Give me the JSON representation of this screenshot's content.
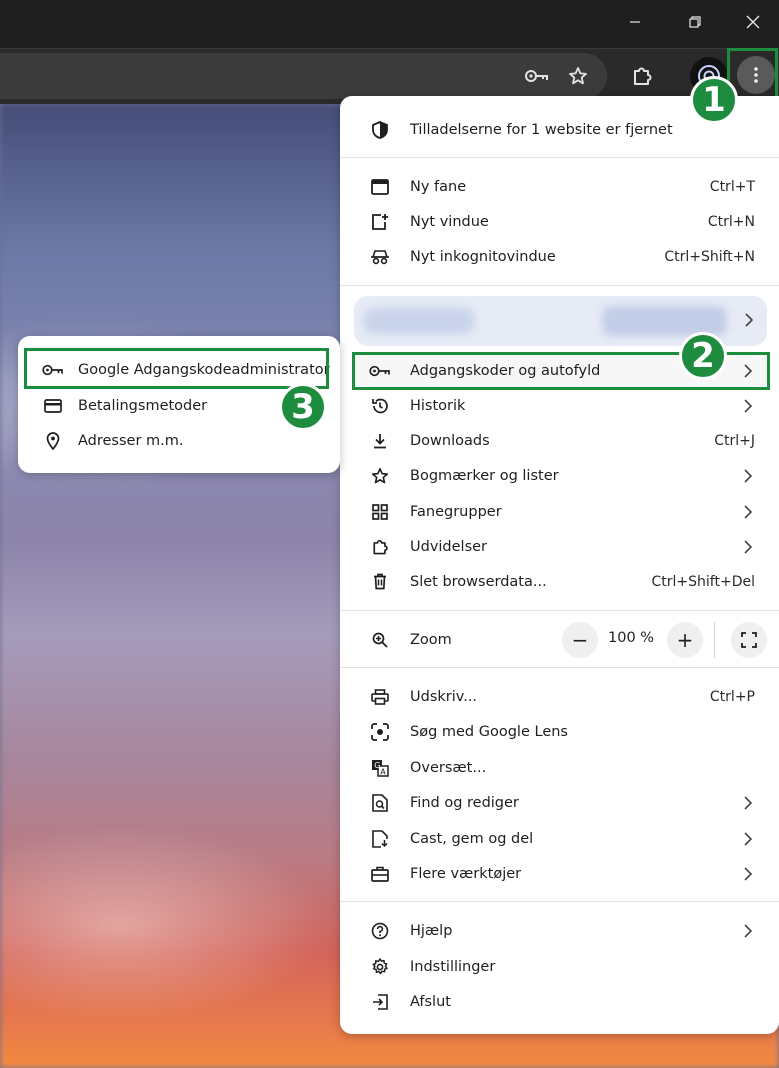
{
  "window": {
    "controls": {
      "minimize_icon": "minimize-icon",
      "restore_icon": "restore-icon",
      "close_icon": "close-icon"
    }
  },
  "toolbar": {
    "icons": [
      "key-icon",
      "star-icon",
      "extensions-icon",
      "profile-icon",
      "more-vert-icon"
    ]
  },
  "badges": {
    "one": "1",
    "two": "2",
    "three": "3"
  },
  "menu": {
    "notice": "Tilladelserne for 1 website er fjernet",
    "new_tab": {
      "label": "Ny fane",
      "shortcut": "Ctrl+T"
    },
    "new_window": {
      "label": "Nyt vindue",
      "shortcut": "Ctrl+N"
    },
    "incognito": {
      "label": "Nyt inkognitovindue",
      "shortcut": "Ctrl+Shift+N"
    },
    "passwords": {
      "label": "Adgangskoder og autofyld"
    },
    "history": {
      "label": "Historik"
    },
    "downloads": {
      "label": "Downloads",
      "shortcut": "Ctrl+J"
    },
    "bookmarks": {
      "label": "Bogmærker og lister"
    },
    "tab_groups": {
      "label": "Fanegrupper"
    },
    "extensions": {
      "label": "Udvidelser"
    },
    "clear_data": {
      "label": "Slet browserdata...",
      "shortcut": "Ctrl+Shift+Del"
    },
    "zoom": {
      "label": "Zoom",
      "value": "100 %",
      "minus": "−",
      "plus": "+"
    },
    "print": {
      "label": "Udskriv...",
      "shortcut": "Ctrl+P"
    },
    "lens": {
      "label": "Søg med Google Lens"
    },
    "translate": {
      "label": "Oversæt..."
    },
    "find": {
      "label": "Find og rediger"
    },
    "cast": {
      "label": "Cast, gem og del"
    },
    "more_tools": {
      "label": "Flere værktøjer"
    },
    "help": {
      "label": "Hjælp"
    },
    "settings": {
      "label": "Indstillinger"
    },
    "exit": {
      "label": "Afslut"
    }
  },
  "submenu": {
    "password_manager": "Google Adgangskodeadministrator",
    "payment_methods": "Betalingsmetoder",
    "addresses": "Adresser m.m."
  },
  "colors": {
    "highlight": "#1e8c3e",
    "menu_bg": "#ffffff",
    "toolbar_bg": "#2a2a2a"
  }
}
